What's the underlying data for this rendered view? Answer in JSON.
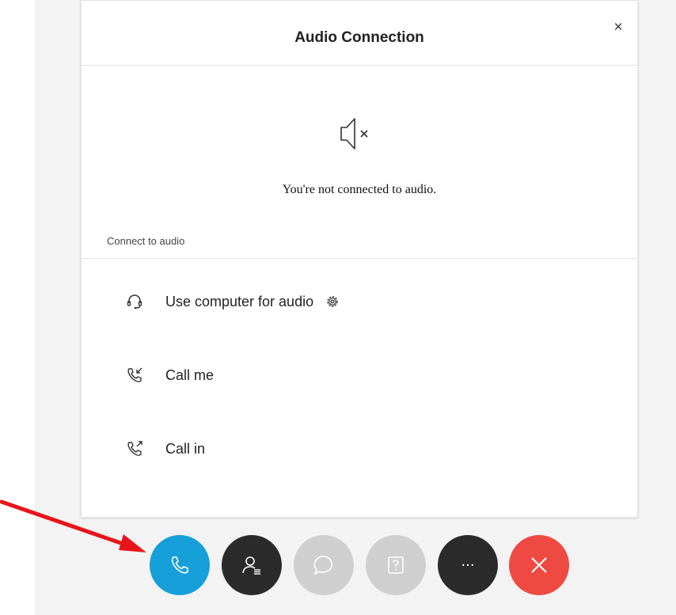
{
  "dialog": {
    "title": "Audio Connection",
    "close_label": "×",
    "status_icon": "speaker-muted-icon",
    "status_text": "You're not connected to audio.",
    "section_label": "Connect to audio",
    "options": [
      {
        "label": "Use computer for audio",
        "icon": "headset-icon",
        "extra_icon": "gear-icon"
      },
      {
        "label": "Call me",
        "icon": "phone-incoming-icon"
      },
      {
        "label": "Call in",
        "icon": "phone-outgoing-icon"
      }
    ]
  },
  "controls": [
    {
      "name": "audio",
      "icon": "phone-icon",
      "color": "#169fd9"
    },
    {
      "name": "participants",
      "icon": "participants-icon",
      "color": "#2b2b2b"
    },
    {
      "name": "chat",
      "icon": "chat-icon",
      "color": "#cfcfcf"
    },
    {
      "name": "qa",
      "icon": "question-icon",
      "color": "#cfcfcf"
    },
    {
      "name": "more",
      "icon": "more-icon",
      "color": "#2b2b2b",
      "label": "···"
    },
    {
      "name": "leave",
      "icon": "close-icon",
      "color": "#ee4a43"
    }
  ],
  "annotation": {
    "arrow_color": "#e8141b"
  }
}
